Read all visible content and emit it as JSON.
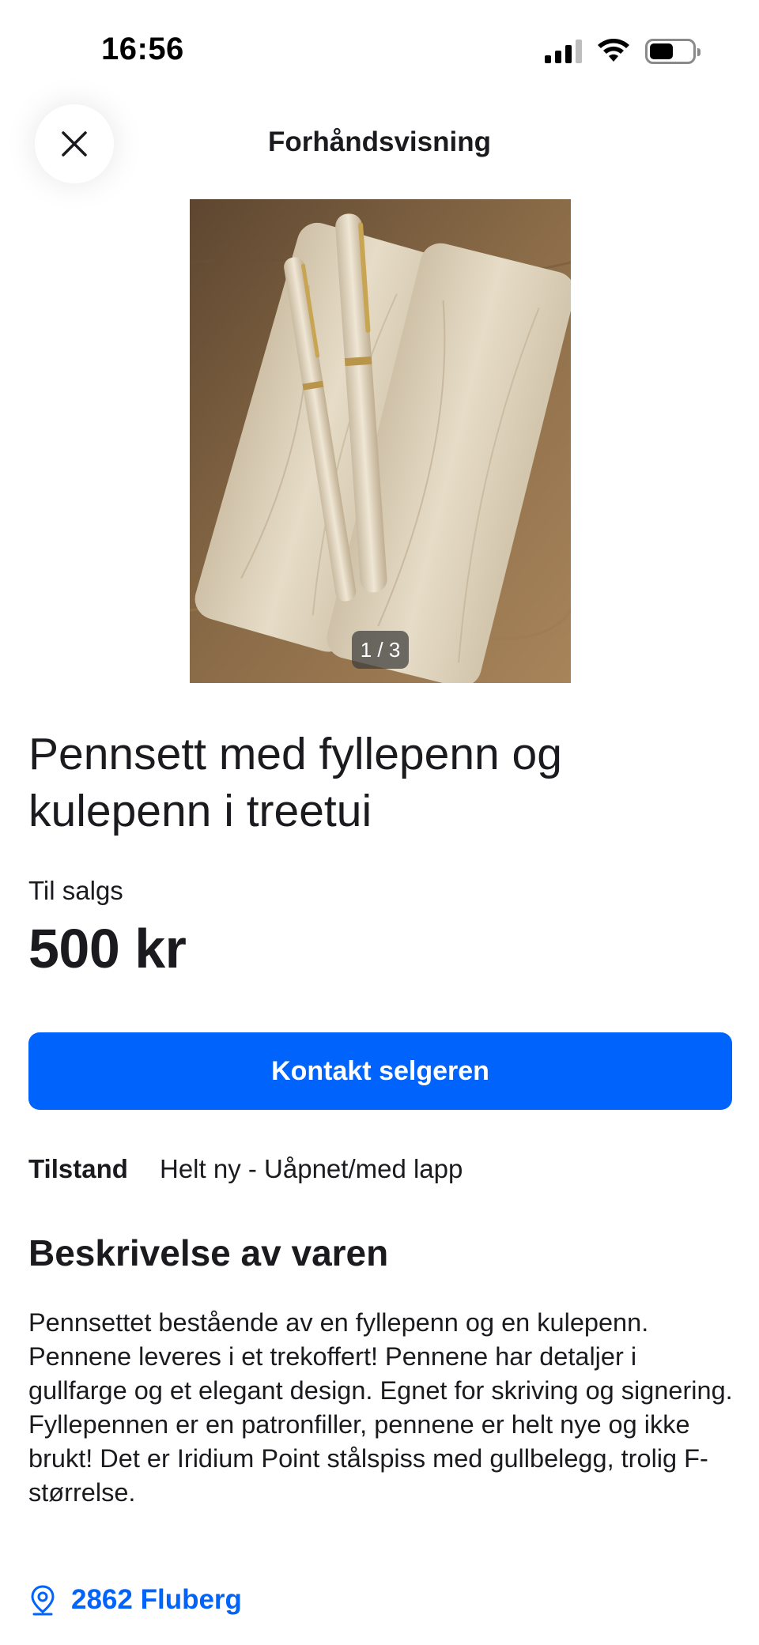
{
  "status_bar": {
    "time": "16:56",
    "icons": [
      "signal-icon",
      "wifi-icon",
      "battery-icon"
    ]
  },
  "header": {
    "close_icon": "close-icon",
    "title": "Forhåndsvisning"
  },
  "gallery": {
    "counter": "1 / 3",
    "current": 1,
    "total": 3
  },
  "listing": {
    "title": "Pennsett med fyllepenn og kulepenn i treetui",
    "sale_type": "Til salgs",
    "price": "500 kr",
    "contact_button": "Kontakt selgeren",
    "condition_label": "Tilstand",
    "condition_value": "Helt ny - Uåpnet/med lapp"
  },
  "description": {
    "heading": "Beskrivelse av varen",
    "paragraphs": [
      "Pennsettet bestående av en fyllepenn og en kulepenn. Pennene leveres i et trekoffert! Pennene har detaljer i gullfarge og et elegant design. Egnet for skriving og signering.",
      "Fyllepennen er en patronfiller, pennene er helt nye og ikke brukt! Det er Iridium Point stålspiss med gullbelegg, trolig F-størrelse."
    ]
  },
  "location": {
    "icon": "location-pin-icon",
    "text": "2862 Fluberg"
  },
  "colors": {
    "accent": "#0063fb",
    "text": "#1b1b1f",
    "background": "#ffffff"
  }
}
